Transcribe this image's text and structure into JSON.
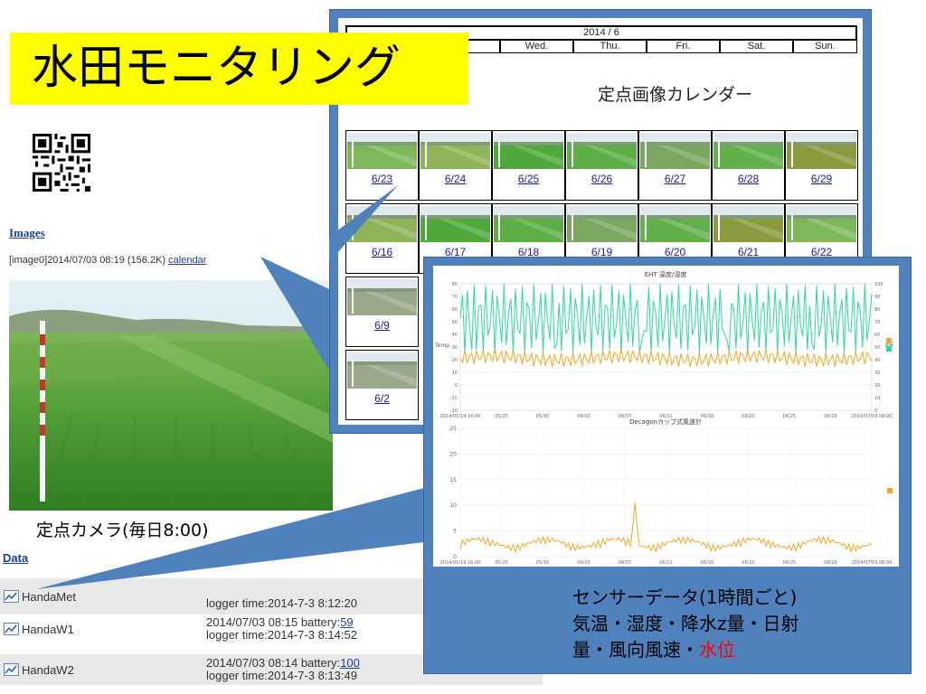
{
  "headline": "水田モニタリング",
  "page": {
    "images_link": "Images",
    "image_meta": "[image0]2014/07/03 08:19 (156.2K)",
    "image_meta_link": "calendar",
    "camera_caption": "定点カメラ(毎日8:00)",
    "data_link": "Data",
    "data_rows": [
      {
        "name": "HandaMet",
        "line1": "",
        "battery": "",
        "line2": "logger time:2014-7-3 8:12:20"
      },
      {
        "name": "HandaW1",
        "line1": "2014/07/03 08:15 battery:",
        "battery": "59",
        "line2": "logger time:2014-7-3 8:14:52"
      },
      {
        "name": "HandaW2",
        "line1": "2014/07/03 08:14 battery:",
        "battery": "100",
        "line2": "logger time:2014-7-3 8:13:49"
      }
    ]
  },
  "calendar": {
    "month": "2014 / 6",
    "days_of_week": [
      "Wed.",
      "Thu.",
      "Fri.",
      "Sat.",
      "Sun."
    ],
    "title": "定点画像カレンダー",
    "weeks": [
      [
        "6/23",
        "6/24",
        "6/25",
        "6/26",
        "6/27",
        "6/28",
        "6/29"
      ],
      [
        "6/16",
        "6/17",
        "6/18",
        "6/19",
        "6/20",
        "6/21",
        "6/22"
      ],
      [
        "6/9"
      ],
      [
        "6/2"
      ]
    ]
  },
  "charts": {
    "chart1_title": "EHT 温度/湿度",
    "chart2_title": "Decagonカップ式風速計",
    "chart1_left_label": "Temp.",
    "chart1_right_label": "RH"
  },
  "sensor_text": {
    "line1": "センサーデータ(1時間ごと)",
    "line2": "気温・湿度・降水z量・日射",
    "line3_black": "量・風向風速・",
    "line3_red": "水位"
  },
  "colors": {
    "headline_bg": "#ffff00",
    "panel_blue": "#4f81bd",
    "temp_line": "#f5a623",
    "rh_line": "#2ed8a0",
    "wind_line": "#f5a623",
    "link": "#1a3fa0"
  },
  "chart_data": [
    {
      "type": "line",
      "title": "EHT 温度/湿度",
      "x": [
        "2014/05/19 16:00",
        "05/25",
        "05/30",
        "06/03",
        "06/07",
        "06/11",
        "06/16",
        "06/20",
        "06/25",
        "06/29",
        "2014/07/03 08:00"
      ],
      "ylabel": "Temp.",
      "ylabel_right": "RH",
      "ylim": [
        -20,
        80
      ],
      "ylim_right": [
        0,
        100
      ],
      "series": [
        {
          "name": "Temp.",
          "axis": "left",
          "summary_range": [
            14,
            30
          ]
        },
        {
          "name": "RH",
          "axis": "right",
          "summary_range": [
            45,
            100
          ]
        }
      ]
    },
    {
      "type": "line",
      "title": "Decagonカップ式風速計",
      "x": [
        "2014/05/19 16:00",
        "05/25",
        "05/30",
        "06/03",
        "06/07",
        "06/11",
        "06/16",
        "06/20",
        "06/25",
        "06/29",
        "2014/07/03 08:00"
      ],
      "ylim": [
        0,
        25
      ],
      "series": [
        {
          "name": "wind",
          "peak": 10.5,
          "peak_at": "06/06"
        }
      ]
    }
  ]
}
